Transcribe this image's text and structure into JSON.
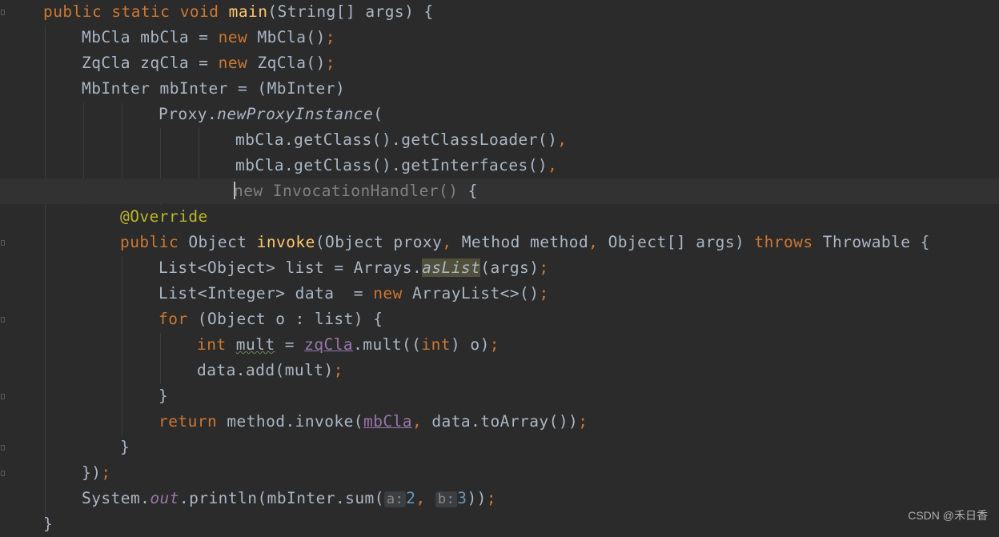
{
  "editor": {
    "lines": [
      {
        "tokens": [
          "public",
          "static",
          "void",
          "main",
          "(String[] args) {"
        ]
      },
      {
        "tokens": [
          "MbCla mbCla = ",
          "new",
          " MbCla()",
          ";"
        ]
      },
      {
        "tokens": [
          "ZqCla zqCla = ",
          "new",
          " ZqCla()",
          ";"
        ]
      },
      {
        "tokens": [
          "MbInter mbInter = (MbInter)"
        ]
      },
      {
        "tokens": [
          "Proxy.",
          "newProxyInstance",
          "("
        ]
      },
      {
        "tokens": [
          "mbCla.getClass().getClassLoader()",
          ","
        ]
      },
      {
        "tokens": [
          "mbCla.getClass().getInterfaces()",
          ","
        ]
      },
      {
        "tokens": [
          "new",
          " InvocationHandler()",
          " {"
        ]
      },
      {
        "tokens": [
          "@Override"
        ]
      },
      {
        "tokens": [
          "public",
          " Object ",
          "invoke",
          "(Object proxy",
          ", ",
          "Method method",
          ", ",
          "Object[] args) ",
          "throws",
          " Throwable {"
        ]
      },
      {
        "tokens": [
          "List<Object> list = Arrays.",
          "asList",
          "(args)",
          ";"
        ]
      },
      {
        "tokens": [
          "List<Integer> data  = ",
          "new",
          " ArrayList<>()",
          ";"
        ]
      },
      {
        "tokens": [
          "for",
          " (Object o : list) {"
        ]
      },
      {
        "tokens": [
          "int",
          " ",
          "mult",
          " = ",
          "zqCla",
          ".mult((",
          "int",
          ") o)",
          ";"
        ]
      },
      {
        "tokens": [
          "data.add(mult)",
          ";"
        ]
      },
      {
        "tokens": [
          "}"
        ]
      },
      {
        "tokens": [
          "return",
          " method.invoke(",
          "mbCla",
          ", ",
          "data.toArray())",
          ";"
        ]
      },
      {
        "tokens": [
          "}"
        ]
      },
      {
        "tokens": [
          "})",
          ";"
        ]
      },
      {
        "tokens": [
          "System.",
          "out",
          ".println(mbInter.sum(",
          "a:",
          "2",
          ",",
          "b:",
          "3",
          "))",
          ";"
        ]
      },
      {
        "tokens": [
          "}"
        ]
      }
    ]
  },
  "watermark": "CSDN @禾日香",
  "colors": {
    "background": "#2b2b2b",
    "current_line": "#323232",
    "keyword": "#cc7832",
    "function": "#ffc66d",
    "plain": "#a9b7c6",
    "field": "#9876aa",
    "annotation": "#bbb529",
    "number": "#6897bb",
    "hint_bg": "#3b3f41"
  }
}
